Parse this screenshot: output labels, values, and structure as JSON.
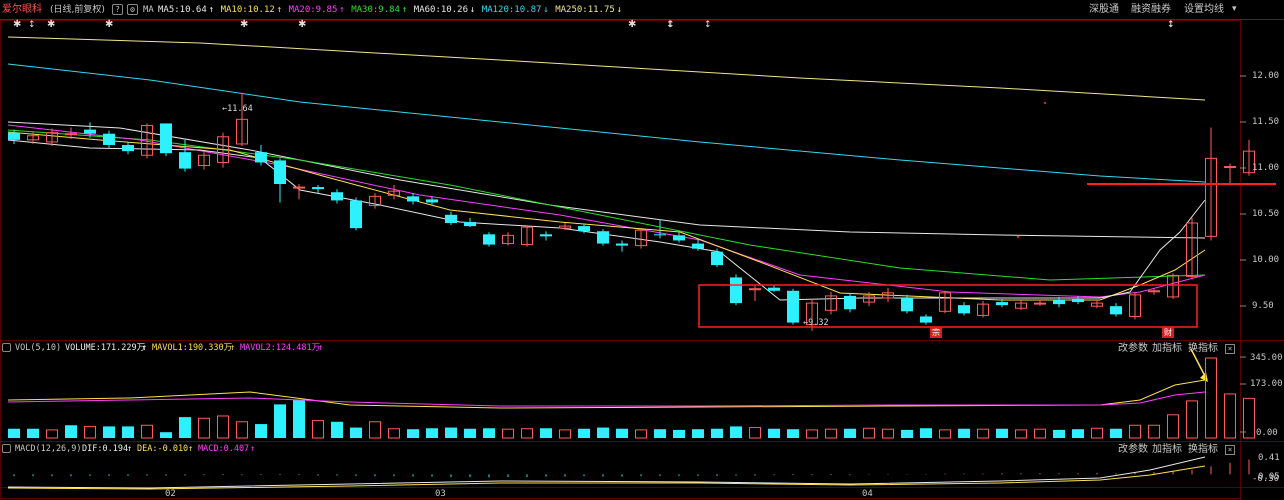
{
  "stock": {
    "name": "爱尔眼科",
    "period": "(日线,前复权)",
    "help": "?",
    "settings_symbol": "⚙",
    "ma_label": "MA"
  },
  "ma_values": [
    {
      "label": "MA5:10.64",
      "arrow": "↑",
      "color": "#e8e8e8"
    },
    {
      "label": "MA10:10.12",
      "arrow": "↑",
      "color": "#ffe14d"
    },
    {
      "label": "MA20:9.85",
      "arrow": "↑",
      "color": "#ff3dff"
    },
    {
      "label": "MA30:9.84",
      "arrow": "↑",
      "color": "#28e028"
    },
    {
      "label": "MA60:10.26",
      "arrow": "↓",
      "color": "#e8e8e8"
    },
    {
      "label": "MA120:10.87",
      "arrow": "↓",
      "color": "#36d8f0"
    },
    {
      "label": "MA250:11.75",
      "arrow": "↓",
      "color": "#f0e68c"
    }
  ],
  "toolbar": {
    "shenguntong": "深股通",
    "margin": "融资融券",
    "settings": "设置均线",
    "dropdown": "▾"
  },
  "price_axis": [
    "12.00",
    "11.50",
    "11.00",
    "10.50",
    "10.00",
    "9.50"
  ],
  "annotations": {
    "high": "11.64",
    "low": "9.32",
    "badge1": "宗",
    "badge2": "财"
  },
  "vol_panel": {
    "title": "VOL(5,10)",
    "volume": "VOLUME:171.229万",
    "arrow": "↑",
    "mavol1": "MAVOL1:190.330万",
    "arrow1": "↑",
    "mavol2": "MAVOL2:124.481万",
    "arrow2": "↑",
    "btn_params": "改参数",
    "btn_add": "加指标",
    "btn_switch": "换指标",
    "close": "×",
    "axis": [
      "345.00",
      "173.00",
      "0.00"
    ]
  },
  "macd_panel": {
    "title": "MACD(12,26,9)",
    "dif": "DIF:0.194",
    "arrow1": "↑",
    "dea": "DEA:-0.010",
    "arrow2": "↑",
    "macd": "MACD:0.407",
    "arrow3": "↑",
    "btn_params": "改参数",
    "btn_add": "加指标",
    "btn_switch": "换指标",
    "close": "×",
    "axis": [
      "0.41",
      "0.05",
      "-0.30"
    ]
  },
  "months": [
    "02",
    "03",
    "04"
  ],
  "chart_data": {
    "type": "candlestick",
    "candles": [
      [
        11.25,
        11.18,
        11.28,
        11.14
      ],
      [
        11.18,
        11.22,
        11.26,
        11.14
      ],
      [
        11.16,
        11.25,
        11.29,
        11.12
      ],
      [
        11.23,
        11.24,
        11.3,
        11.19
      ],
      [
        11.28,
        11.24,
        11.35,
        11.2
      ],
      [
        11.24,
        11.13,
        11.27,
        11.1
      ],
      [
        11.13,
        11.07,
        11.16,
        11.04
      ],
      [
        11.03,
        11.32,
        11.34,
        11.0
      ],
      [
        11.34,
        11.05,
        11.34,
        11.02
      ],
      [
        11.06,
        10.9,
        11.18,
        10.87
      ],
      [
        10.93,
        11.03,
        11.06,
        10.89
      ],
      [
        10.96,
        11.21,
        11.25,
        10.91
      ],
      [
        11.14,
        11.38,
        11.64,
        11.12
      ],
      [
        11.06,
        10.96,
        11.13,
        10.93
      ],
      [
        10.98,
        10.75,
        11.0,
        10.57
      ],
      [
        10.72,
        10.72,
        10.75,
        10.6
      ],
      [
        10.72,
        10.7,
        10.74,
        10.66
      ],
      [
        10.67,
        10.59,
        10.7,
        10.56
      ],
      [
        10.59,
        10.32,
        10.62,
        10.3
      ],
      [
        10.54,
        10.63,
        10.66,
        10.51
      ],
      [
        10.64,
        10.68,
        10.74,
        10.6
      ],
      [
        10.63,
        10.58,
        10.66,
        10.55
      ],
      [
        10.6,
        10.57,
        10.63,
        10.55
      ],
      [
        10.45,
        10.37,
        10.48,
        10.35
      ],
      [
        10.38,
        10.34,
        10.42,
        10.33
      ],
      [
        10.26,
        10.16,
        10.28,
        10.14
      ],
      [
        10.17,
        10.25,
        10.28,
        10.15
      ],
      [
        10.16,
        10.33,
        10.35,
        10.14
      ],
      [
        10.26,
        10.24,
        10.29,
        10.2
      ],
      [
        10.32,
        10.34,
        10.37,
        10.3
      ],
      [
        10.34,
        10.29,
        10.36,
        10.27
      ],
      [
        10.29,
        10.17,
        10.31,
        10.15
      ],
      [
        10.17,
        10.15,
        10.2,
        10.09
      ],
      [
        10.15,
        10.3,
        10.31,
        10.12
      ],
      [
        10.26,
        10.25,
        10.4,
        10.22
      ],
      [
        10.25,
        10.2,
        10.28,
        10.18
      ],
      [
        10.17,
        10.12,
        10.21,
        10.1
      ],
      [
        10.09,
        9.96,
        10.12,
        9.94
      ],
      [
        9.84,
        9.59,
        9.87,
        9.57
      ],
      [
        9.73,
        9.73,
        9.76,
        9.61
      ],
      [
        9.74,
        9.71,
        9.76,
        9.7
      ],
      [
        9.71,
        9.4,
        9.73,
        9.38
      ],
      [
        9.38,
        9.59,
        9.63,
        9.32
      ],
      [
        9.52,
        9.66,
        9.7,
        9.48
      ],
      [
        9.66,
        9.53,
        9.69,
        9.5
      ],
      [
        9.6,
        9.66,
        9.7,
        9.56
      ],
      [
        9.64,
        9.69,
        9.74,
        9.6
      ],
      [
        9.64,
        9.51,
        9.67,
        9.49
      ],
      [
        9.46,
        9.4,
        9.48,
        9.38
      ],
      [
        9.51,
        9.69,
        9.71,
        9.49
      ],
      [
        9.57,
        9.49,
        9.6,
        9.47
      ],
      [
        9.47,
        9.58,
        9.61,
        9.45
      ],
      [
        9.6,
        9.57,
        9.63,
        9.55
      ],
      [
        9.54,
        9.59,
        9.62,
        9.52
      ],
      [
        9.59,
        9.59,
        9.62,
        9.56
      ],
      [
        9.62,
        9.58,
        9.65,
        9.55
      ],
      [
        9.63,
        9.6,
        9.66,
        9.58
      ],
      [
        9.56,
        9.59,
        9.62,
        9.54
      ],
      [
        9.56,
        9.48,
        9.59,
        9.46
      ],
      [
        9.46,
        9.67,
        9.7,
        9.43
      ],
      [
        9.71,
        9.71,
        9.73,
        9.67
      ],
      [
        9.65,
        9.86,
        9.88,
        9.63
      ],
      [
        9.85,
        10.37,
        10.42,
        9.82
      ],
      [
        10.24,
        11.0,
        11.3,
        10.2
      ],
      [
        10.92,
        10.92,
        10.95,
        10.74
      ],
      [
        10.86,
        11.07,
        11.18,
        10.83
      ]
    ],
    "volume": [
      40,
      40,
      35,
      55,
      50,
      50,
      50,
      55,
      25,
      90,
      85,
      95,
      70,
      60,
      145,
      165,
      75,
      70,
      45,
      70,
      40,
      38,
      42,
      45,
      40,
      42,
      38,
      40,
      42,
      35,
      40,
      45,
      40,
      35,
      38,
      35,
      38,
      40,
      50,
      45,
      40,
      38,
      35,
      38,
      40,
      42,
      38,
      35,
      42,
      35,
      40,
      38,
      40,
      35,
      38,
      35,
      38,
      42,
      40,
      55,
      55,
      100,
      160,
      345,
      190,
      171
    ],
    "volume_up": [
      false,
      false,
      true,
      false,
      true,
      false,
      false,
      true,
      false,
      false,
      true,
      true,
      true,
      false,
      false,
      false,
      true,
      false,
      false,
      true,
      true,
      false,
      false,
      false,
      false,
      false,
      true,
      true,
      false,
      true,
      false,
      false,
      false,
      true,
      false,
      false,
      false,
      false,
      false,
      true,
      false,
      false,
      true,
      true,
      false,
      true,
      true,
      false,
      false,
      true,
      false,
      true,
      false,
      true,
      true,
      false,
      false,
      true,
      false,
      true,
      true,
      true,
      true,
      true,
      true,
      true
    ],
    "macd_bars": [
      -0.05,
      -0.05,
      -0.05,
      -0.05,
      -0.04,
      -0.04,
      -0.04,
      -0.03,
      -0.03,
      -0.03,
      -0.02,
      -0.02,
      -0.02,
      -0.02,
      -0.02,
      -0.02,
      -0.03,
      -0.03,
      -0.04,
      -0.05,
      -0.05,
      -0.06,
      -0.06,
      -0.07,
      -0.07,
      -0.08,
      -0.07,
      -0.07,
      -0.06,
      -0.06,
      -0.05,
      -0.06,
      -0.06,
      -0.05,
      -0.04,
      -0.04,
      -0.04,
      -0.04,
      -0.03,
      -0.03,
      -0.02,
      -0.02,
      -0.02,
      -0.02,
      -0.02,
      -0.01,
      -0.01,
      0.01,
      0.01,
      0.02,
      0.02,
      0.02,
      0.03,
      0.03,
      0.03,
      0.03,
      0.03,
      0.04,
      0.03,
      0.05,
      0.06,
      0.08,
      0.12,
      0.22,
      0.32,
      0.41
    ],
    "price_range": [
      9.25,
      12.25
    ],
    "macd_range": [
      -0.32,
      0.45
    ]
  }
}
